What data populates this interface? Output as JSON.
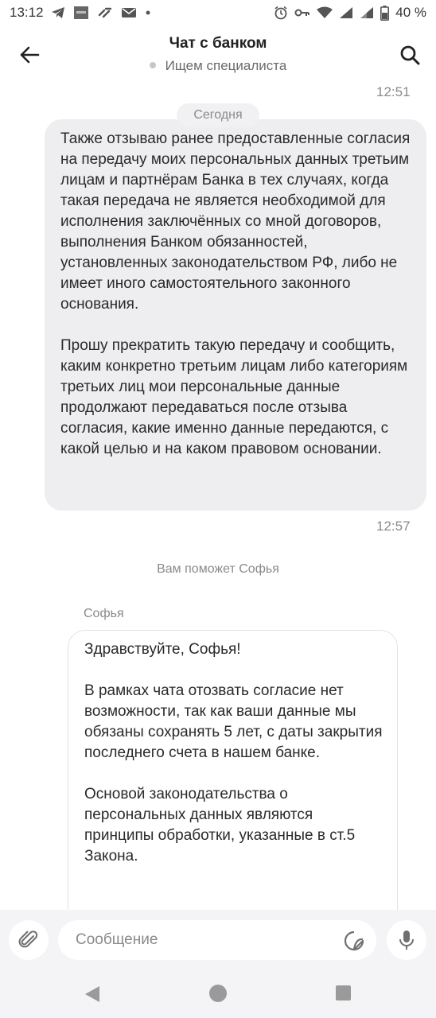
{
  "status_bar": {
    "time": "13:12",
    "battery": "40 %",
    "icons": [
      "telegram-icon",
      "app-icon",
      "link-icon",
      "mail-icon",
      "dot-icon",
      "alarm-icon",
      "key-icon",
      "wifi-icon",
      "signal-icon",
      "signal-icon",
      "battery-icon"
    ]
  },
  "header": {
    "title": "Чат с банком",
    "subtitle": "Ищем специалиста",
    "icons": [
      "back-arrow-icon",
      "search-icon"
    ]
  },
  "chat": {
    "time_first": "12:51",
    "date_separator": "Сегодня",
    "outgoing": {
      "paragraphs": [
        "Также отзываю ранее предоставленные согласия на передачу моих персональных данных третьим лицам и партнёрам Банка в тех случаях, когда такая передача не является необходимой для исполнения заключённых со мной договоров, выполнения Банком обязанностей, установленных законодательством РФ, либо не имеет иного самостоятельного законного основания.",
        "Прошу прекратить такую передачу и сообщить, каким конкретно третьим лицам либо категориям третьих лиц мои персональные данные продолжают передаваться после отзыва согласия, какие именно данные передаются, с какой целью и на каком правовом основании."
      ],
      "time": "12:57"
    },
    "system_note": "Вам поможет Софья",
    "incoming": {
      "sender": "Софья",
      "paragraphs": [
        "Здравствуйте, Софья!",
        "В рамках чата отозвать согласие нет возможности, так как ваши данные мы обязаны сохранять 5 лет, с даты закрытия последнего счета в нашем банке.",
        "Основой законодательства о персональных данных являются принципы обработки, указанные в ст.5 Закона."
      ]
    }
  },
  "composer": {
    "placeholder": "Сообщение",
    "icons": [
      "paperclip-icon",
      "sticker-icon",
      "microphone-icon"
    ]
  },
  "nav_bar": {
    "icons": [
      "nav-back-icon",
      "nav-home-icon",
      "nav-recents-icon"
    ]
  },
  "colors": {
    "outgoing_bubble": "#eeeef0",
    "muted_text": "#8a8a8a",
    "composer_bg": "#f4f4f6"
  }
}
